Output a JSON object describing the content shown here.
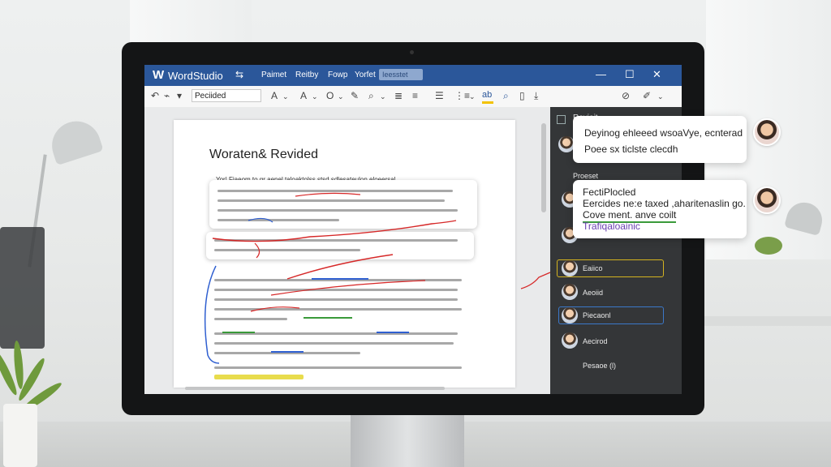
{
  "app": {
    "logo": "W",
    "title": "WordStudio",
    "menus": [
      "Paimet",
      "Reitby",
      "Fowp",
      "Yorfet"
    ],
    "search_placeholder": "Ieesstet",
    "window_controls": {
      "minimize": "—",
      "maximize": "☐",
      "close": "✕"
    }
  },
  "ribbon": {
    "font_name": "Peciided",
    "icons": [
      "undo-icon",
      "format-painter-icon",
      "font-color-icon",
      "text-effects-icon",
      "shading-icon",
      "pen-icon",
      "highlighter-icon",
      "align-center-icon",
      "align-justify-icon",
      "bullets-icon",
      "numbering-icon",
      "indent-icon",
      "text-highlight-icon",
      "find-icon",
      "spelling-icon",
      "share-icon",
      "editor-icon"
    ]
  },
  "document": {
    "title": "Woraten& Revided",
    "first_line": "Yor| Fiaeom to gr aenel taloaktolss stsd sdlesateulon eloeersal",
    "accent_colors": {
      "track_red": "#d62828",
      "track_blue": "#2f5fd0",
      "track_green": "#3a9a3a",
      "highlight": "#f6e94a"
    }
  },
  "comments_panel": {
    "header": "Revieit",
    "section": "Proeset",
    "items": [
      {
        "label": "Eaiico",
        "border": "#d4b320"
      },
      {
        "label": "Aeoiid",
        "border": ""
      },
      {
        "label": "Piecaonl",
        "border": "#3b78c9"
      },
      {
        "label": "Aecirod",
        "border": ""
      }
    ],
    "footer": "Pesaoe (l)"
  },
  "callouts": [
    {
      "lines": [
        "Deyinog ehleeed wsoaVye, ecnterad",
        "Poee sx ticlste clecdh"
      ]
    },
    {
      "lines": [
        "FectiPlocled",
        "Eercides ne:e taxed ,aharitenaslin go.",
        "Cove ment. anve coilt",
        "Trafiqaloainic"
      ]
    }
  ]
}
